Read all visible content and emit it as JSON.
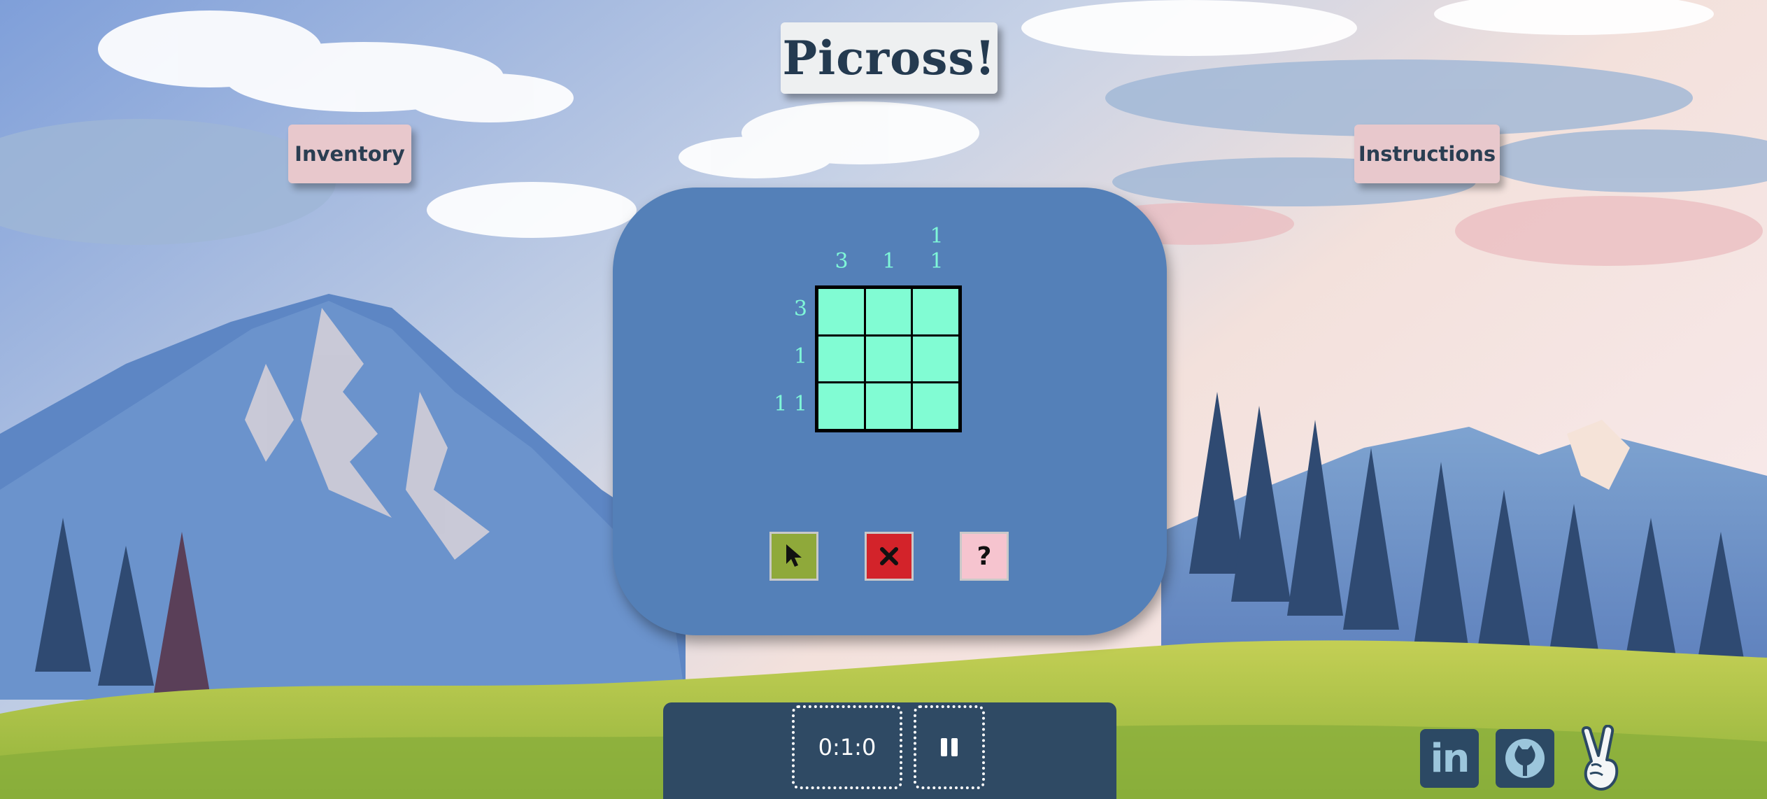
{
  "title": "Picross!",
  "nav": {
    "inventory_label": "Inventory",
    "instructions_label": "Instructions"
  },
  "puzzle": {
    "column_clues": [
      [
        "3"
      ],
      [
        "1"
      ],
      [
        "1",
        "1"
      ]
    ],
    "row_clues": [
      "3",
      "1",
      "1 1"
    ],
    "grid_size": 3,
    "cells_filled": [
      [
        false,
        false,
        false
      ],
      [
        false,
        false,
        false
      ],
      [
        false,
        false,
        false
      ]
    ]
  },
  "tools": {
    "fill_icon": "cursor-icon",
    "cross_icon": "cross-icon",
    "help_label": "?"
  },
  "status": {
    "timer": "0:1:0",
    "pause_icon": "pause-icon"
  },
  "social": {
    "linkedin_label": "in",
    "github_icon": "github-icon",
    "peace_icon": "peace-hand-icon"
  },
  "colors": {
    "panel": "#5480b8",
    "cell": "#81fcd3",
    "clue": "#7ff7d8",
    "fill_tool": "#8fa93a",
    "cross_tool": "#d3232a",
    "help_tool": "#f6c4cf",
    "bar": "#2f4a64"
  }
}
